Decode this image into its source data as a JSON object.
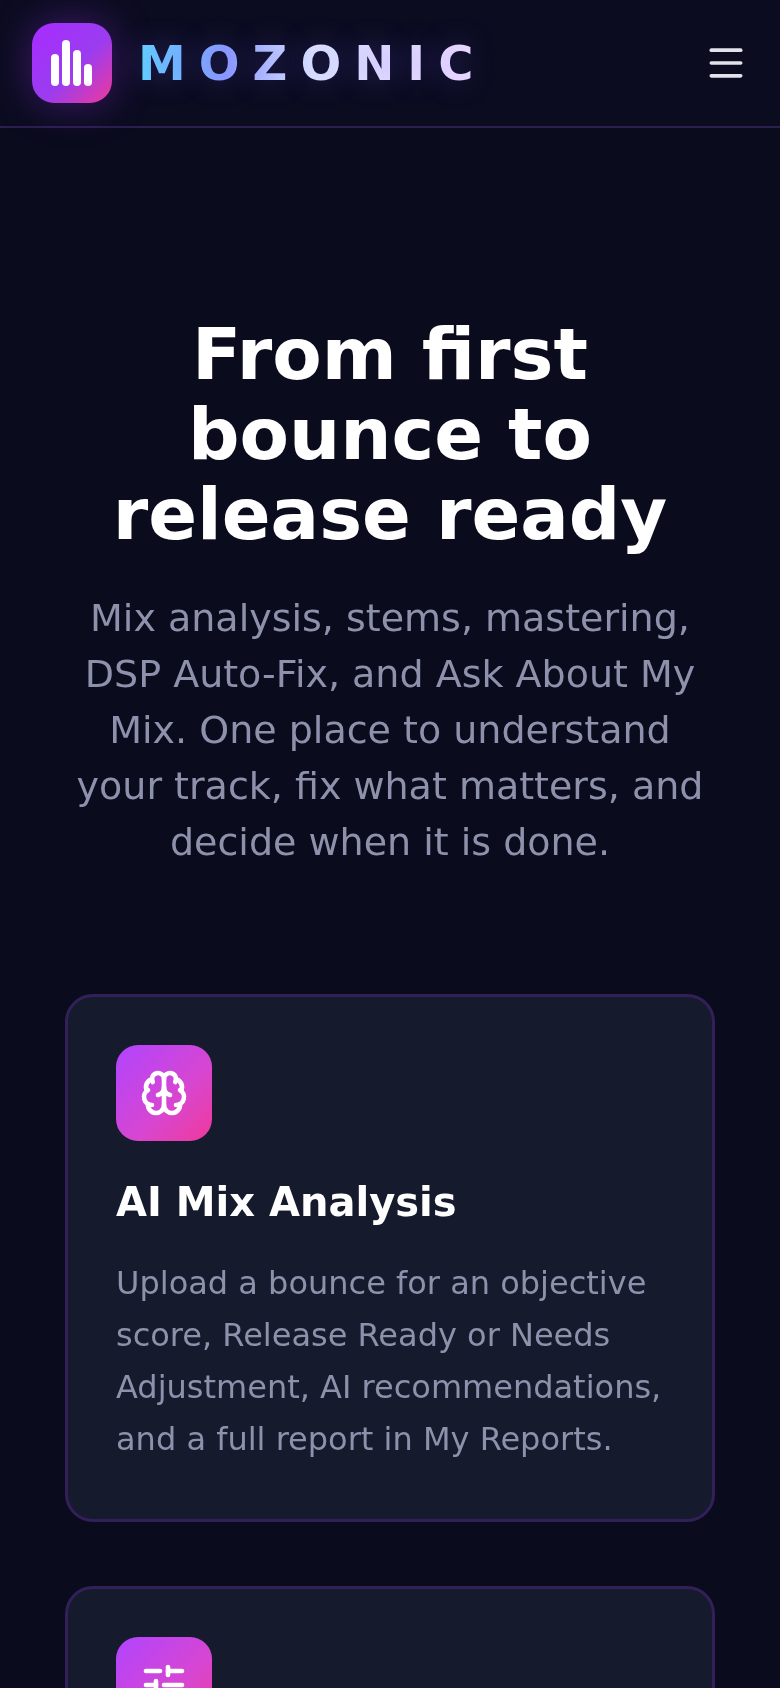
{
  "header": {
    "brand": "MOZONIC"
  },
  "hero": {
    "title": "From first bounce to release ready",
    "subtitle": "Mix analysis, stems, mastering, DSP Auto-Fix, and Ask About My Mix. One place to understand your track, fix what matters, and decide when it is done."
  },
  "features": [
    {
      "kind": "brain",
      "title": "AI Mix Analysis",
      "description": "Upload a bounce for an objective score, Release Ready or Needs Adjustment, AI recommendations, and a full report in My Reports."
    },
    {
      "kind": "sliders"
    }
  ]
}
